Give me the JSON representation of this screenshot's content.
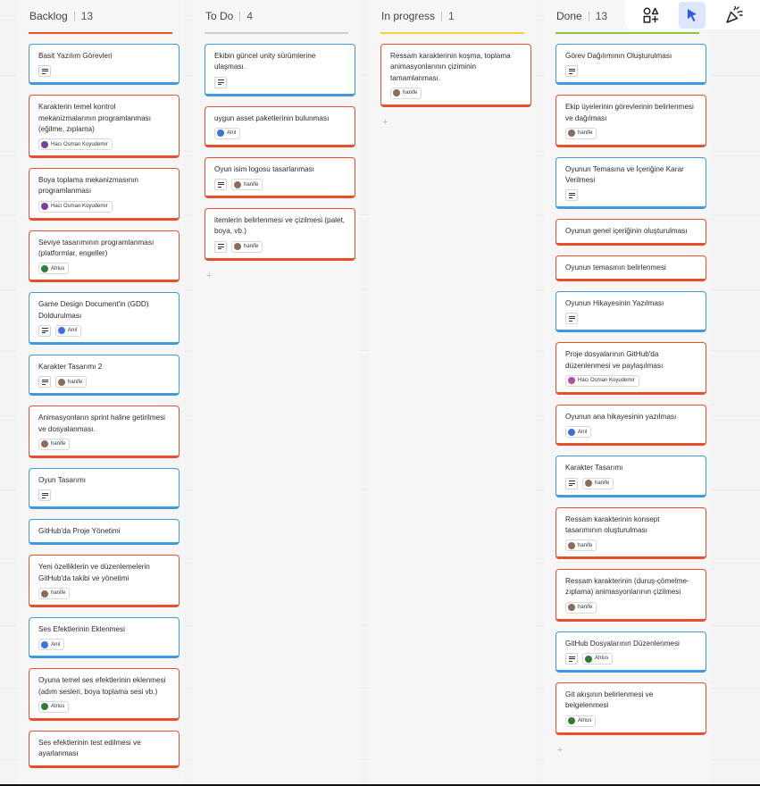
{
  "board": {
    "columns": [
      {
        "title": "Backlog",
        "count": "13",
        "accent": "#e8502c",
        "cards": [
          {
            "text": "Basit Yazılım Görevleri",
            "color": "blue",
            "desc": true
          },
          {
            "text": "Karakterin temel kontrol mekanizmalarının programlanması (eğilme, zıplama)",
            "color": "red",
            "desc": false,
            "assignee": "Hacı Osman Koyudemir",
            "avatar": "#7b3fa0"
          },
          {
            "text": "Boya toplama mekanizmasının programlanması",
            "color": "red",
            "desc": false,
            "assignee": "Hacı Osman Koyudemir",
            "avatar": "#7b3fa0"
          },
          {
            "text": "Seviye tasarımının programlanması (platformlar, engeller)",
            "color": "red",
            "desc": false,
            "assignee": "Atrius",
            "avatar": "#2e7d32"
          },
          {
            "text": "Game Design Document'in (GDD) Doldurulması",
            "color": "blue",
            "desc": true,
            "assignee": "Anıl",
            "avatar": "#3f6fe0"
          },
          {
            "text": "Karakter Tasarımı 2",
            "color": "blue",
            "desc": true,
            "assignee": "hanife",
            "avatar": "#8a6d5a"
          },
          {
            "text": "Animasyonların sprint haline getirilmesi ve dosyalanması.",
            "color": "red",
            "desc": false,
            "assignee": "hanife",
            "avatar": "#8a6d5a"
          },
          {
            "text": "Oyun Tasarımı",
            "color": "blue",
            "desc": true
          },
          {
            "text": "GitHub'da Proje Yönetimi",
            "color": "blue",
            "desc": false
          },
          {
            "text": "Yeni özelliklerin ve düzenlemelerin GitHub'da takibi ve yönetimi",
            "color": "red",
            "desc": false,
            "assignee": "hanife",
            "avatar": "#8a6d5a"
          },
          {
            "text": "Ses Efektlerinin Eklenmesi",
            "color": "blue",
            "desc": false,
            "assignee": "Anıl",
            "avatar": "#3f6fe0"
          },
          {
            "text": "Oyuna temel ses efektlerinin eklenmesi (adım sesleri, boya toplama sesi vb.)",
            "color": "red",
            "desc": false,
            "assignee": "Atrius",
            "avatar": "#2e7d32"
          },
          {
            "text": "Ses efektlerinin test edilmesi ve ayarlanması",
            "color": "red",
            "desc": false
          }
        ]
      },
      {
        "title": "To Do",
        "count": "4",
        "accent": "#cfcfcf",
        "cards": [
          {
            "text": "Ekibin güncel unity sürümlerine ulaşması.",
            "color": "blue",
            "desc": true
          },
          {
            "text": "uygun asset paketlerinin bulunması",
            "color": "red",
            "desc": false,
            "assignee": "Anıl",
            "avatar": "#3f6fe0"
          },
          {
            "text": "Oyun isim logosu tasarlanması",
            "color": "red",
            "desc": true,
            "assignee": "hanife",
            "avatar": "#8a6d5a"
          },
          {
            "text": "itemlerin belirlenmesi ve çizilmesi (palet, boya, vb.)",
            "color": "red",
            "desc": true,
            "assignee": "hanife",
            "avatar": "#8a6d5a"
          }
        ],
        "add": "+"
      },
      {
        "title": "In progress",
        "count": "1",
        "accent": "#f2d03b",
        "cards": [
          {
            "text": "Ressam karakterinin koşma, toplama animasyonlarının çiziminin tamamlanması.",
            "color": "red",
            "desc": false,
            "assignee": "hanife",
            "avatar": "#8a6d5a"
          }
        ],
        "add": "+"
      },
      {
        "title": "Done",
        "count": "13",
        "accent": "#8cc63f",
        "cards": [
          {
            "text": "Görev Dağılımının Oluşturulması",
            "color": "blue",
            "desc": true
          },
          {
            "text": "Ekip üyelerinin görevlerinin belirlenmesi ve dağılması",
            "color": "red",
            "desc": false,
            "assignee": "hanife",
            "avatar": "#8a6d5a"
          },
          {
            "text": "Oyunun Temasına ve İçeriğine Karar Verilmesi",
            "color": "blue",
            "desc": true
          },
          {
            "text": "Oyunun genel içeriğinin oluşturulması",
            "color": "red",
            "desc": false
          },
          {
            "text": "Oyunun temasının belirlenmesi",
            "color": "red",
            "desc": false
          },
          {
            "text": "Oyunun Hikayesinin Yazılması",
            "color": "blue",
            "desc": true
          },
          {
            "text": "Proje dosyalarının GitHub'da düzenlenmesi ve paylaşılması",
            "color": "red",
            "desc": false,
            "assignee": "Hacı Osman Koyudemir",
            "avatar": "#b04fa0"
          },
          {
            "text": "Oyunun ana hikayesinin yazılması",
            "color": "red",
            "desc": false,
            "assignee": "Anıl",
            "avatar": "#3f6fe0"
          },
          {
            "text": "Karakter Tasarımı",
            "color": "blue",
            "desc": true,
            "assignee": "hanife",
            "avatar": "#8a6d5a"
          },
          {
            "text": "Ressam karakterinin konsept tasarımının oluşturulması",
            "color": "red",
            "desc": false,
            "assignee": "hanife",
            "avatar": "#8a6d5a"
          },
          {
            "text": "Ressam karakterinin (duruş-çömelme-zıplama) animasyonlarının çizilmesi",
            "color": "red",
            "desc": false,
            "assignee": "hanife",
            "avatar": "#8a6d5a"
          },
          {
            "text": "GitHub Dosyalarının Düzenlenmesi",
            "color": "blue",
            "desc": true,
            "assignee": "Atrius",
            "avatar": "#2e7d32"
          },
          {
            "text": "Git akışının belirlenmesi ve belgelenmesi",
            "color": "red",
            "desc": false,
            "assignee": "Atrius",
            "avatar": "#2e7d32"
          }
        ],
        "add": "+"
      }
    ]
  },
  "toolbar": {
    "tools": [
      {
        "icon": "shapes-add-icon"
      },
      {
        "icon": "cursor-pointer-icon",
        "active": true
      },
      {
        "icon": "party-popper-icon"
      }
    ]
  }
}
